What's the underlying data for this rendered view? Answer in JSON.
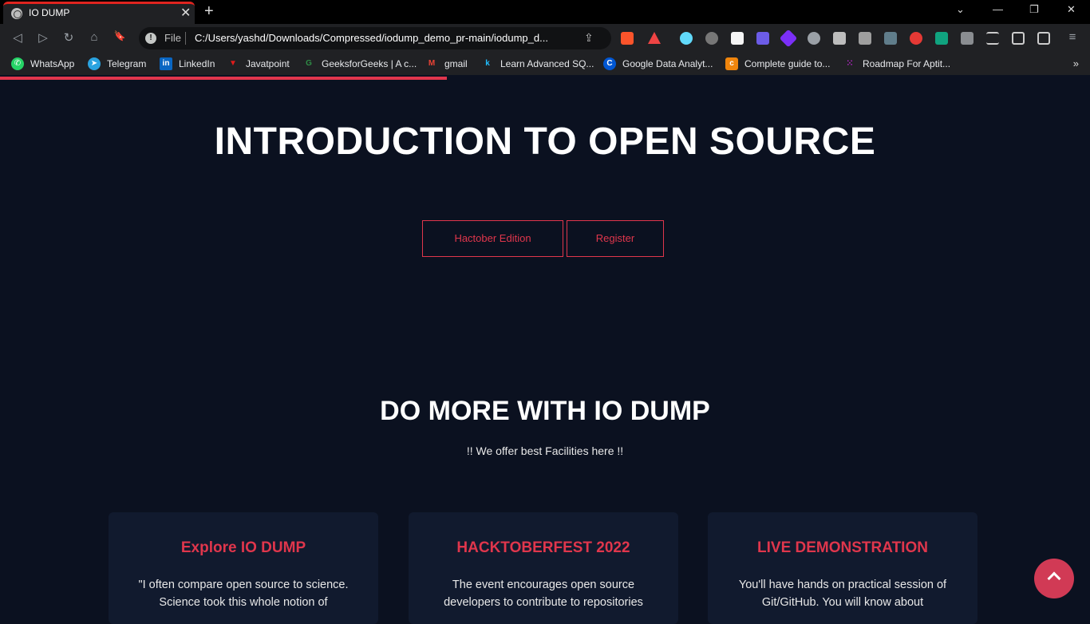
{
  "browser": {
    "tab_title": "IO DUMP",
    "tab_close": "✕",
    "new_tab": "+",
    "url_scheme_label": "File",
    "url": "C:/Users/yashd/Downloads/Compressed/iodump_demo_pr-main/iodump_d...",
    "window_controls": {
      "minimize": "—",
      "restore": "❐",
      "close": "✕",
      "dropdown": "⌄"
    },
    "nav": {
      "back": "◁",
      "forward": "▷",
      "reload": "↻",
      "home": "⌂",
      "bookmark": "🔖"
    },
    "bookmarks": [
      {
        "label": "WhatsApp",
        "icon": "whatsapp-icon",
        "color": "#25d366",
        "glyph": "✆"
      },
      {
        "label": "Telegram",
        "icon": "telegram-icon",
        "color": "#2aa3e0",
        "glyph": "➤"
      },
      {
        "label": "LinkedIn",
        "icon": "linkedin-icon",
        "color": "#0a66c2",
        "glyph": "in"
      },
      {
        "label": "Javatpoint",
        "icon": "javatpoint-icon",
        "color": "#e01b1b",
        "glyph": "▼"
      },
      {
        "label": "GeeksforGeeks | A c...",
        "icon": "geeksforgeeks-icon",
        "color": "#2f8d46",
        "glyph": "G"
      },
      {
        "label": "gmail",
        "icon": "gmail-icon",
        "color": "#ea4335",
        "glyph": "M"
      },
      {
        "label": "Learn Advanced SQ...",
        "icon": "kaggle-icon",
        "color": "#20beff",
        "glyph": "k"
      },
      {
        "label": "Google Data Analyt...",
        "icon": "coursera-icon",
        "color": "#0056d2",
        "glyph": "C"
      },
      {
        "label": "Complete guide to...",
        "icon": "codechef-icon",
        "color": "#f0850c",
        "glyph": "c"
      },
      {
        "label": "Roadmap For Aptit...",
        "icon": "roadmap-icon",
        "color": "#a020a0",
        "glyph": "⁙"
      }
    ],
    "bookmarks_more": "»",
    "load_progress": 0.41
  },
  "hero": {
    "title": "INTRODUCTION TO OPEN SOURCE",
    "button_edition": "Hactober Edition",
    "button_register": "Register"
  },
  "features": {
    "title": "DO MORE WITH IO DUMP",
    "subtitle": "!! We offer best Facilities here !!",
    "cards": [
      {
        "title": "Explore IO DUMP",
        "text": "\"I often compare open source to science. Science took this whole notion of"
      },
      {
        "title": "HACKTOBERFEST 2022",
        "text": "The event encourages open source developers to contribute to repositories"
      },
      {
        "title": "LIVE DEMONSTRATION",
        "text": "You'll have hands on practical session of Git/GitHub. You will know about"
      }
    ]
  },
  "colors": {
    "accent": "#e0364c",
    "page_bg": "#0b1120",
    "card_bg": "#111a2e"
  }
}
